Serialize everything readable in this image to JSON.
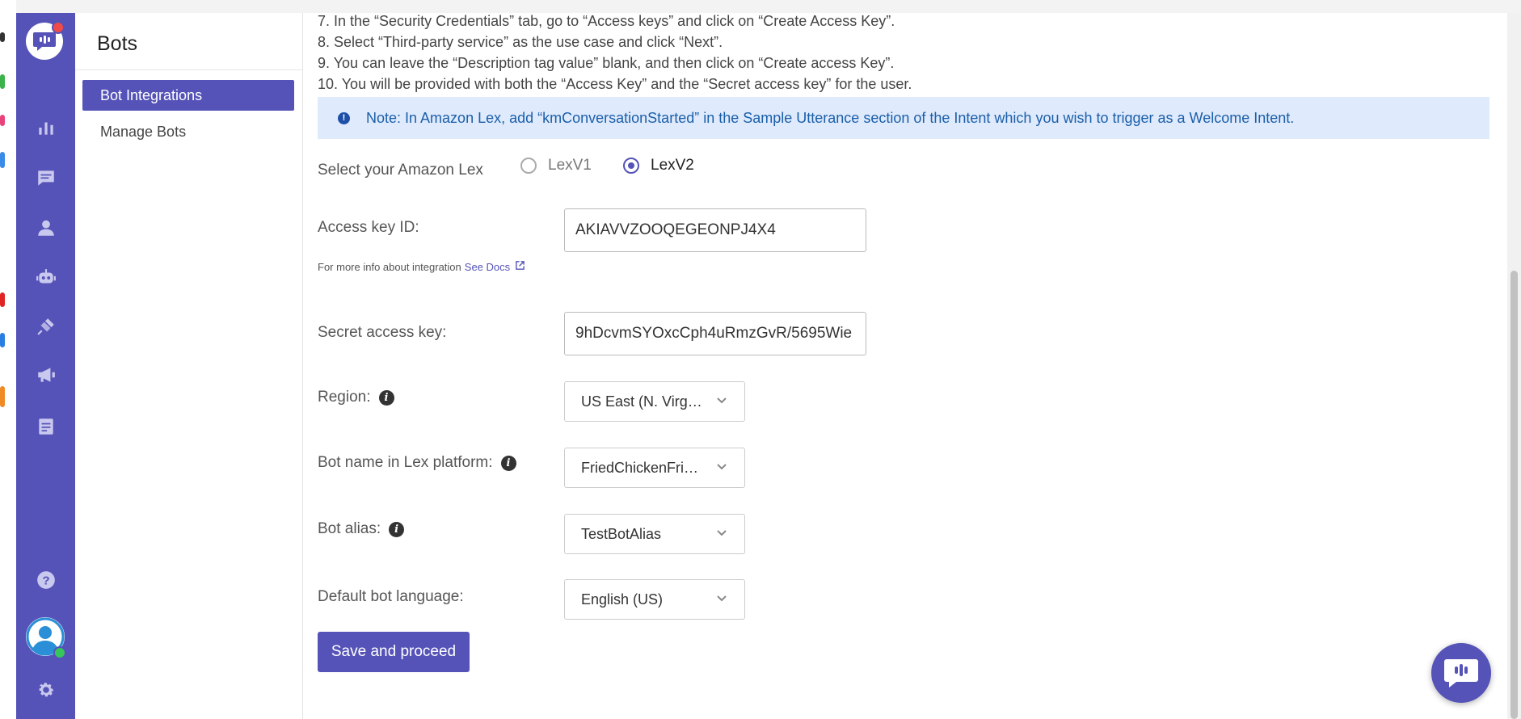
{
  "colors": {
    "brand": "#5553b7",
    "note_bg": "#dfeafd",
    "note_text": "#1b5fa8",
    "online": "#35c759",
    "notification": "#f04a4a"
  },
  "rail": {
    "icons": [
      "logo-chat-icon",
      "reports-icon",
      "conversations-icon",
      "users-icon",
      "bot-icon",
      "integrations-icon",
      "campaigns-icon",
      "docs-icon",
      "help-icon",
      "avatar",
      "settings-icon"
    ]
  },
  "sidebar": {
    "title": "Bots",
    "items": [
      {
        "label": "Bot Integrations",
        "active": true
      },
      {
        "label": "Manage Bots",
        "active": false
      }
    ]
  },
  "main": {
    "steps": [
      "7. In the “Security Credentials” tab, go to “Access keys” and click on “Create Access Key”.",
      "8. Select “Third-party service” as the use case and click “Next”.",
      "9. You can leave the “Description tag value” blank, and then click on “Create access Key”.",
      "10. You will be provided with both the “Access Key” and the “Secret access key” for the user."
    ],
    "note": "Note: In Amazon Lex, add “kmConversationStarted” in the Sample Utterance section of the Intent which you wish to trigger as a Welcome Intent.",
    "lex_select": {
      "label": "Select your Amazon Lex",
      "options": [
        "LexV1",
        "LexV2"
      ],
      "selected": "LexV2"
    },
    "access_key": {
      "label": "Access key ID:",
      "value": "AKIAVVZOOQEGEONPJ4X4"
    },
    "docs": {
      "prefix": "For more info about integration",
      "link": "See Docs"
    },
    "secret_key": {
      "label": "Secret access key:",
      "value": "9hDcvmSYOxcCph4uRmzGvR/5695Wie"
    },
    "region": {
      "label": "Region:",
      "value": "US East (N. Virginia)"
    },
    "bot_name": {
      "label": "Bot name in Lex platform:",
      "value": "FriedChickenFriendBot"
    },
    "bot_alias": {
      "label": "Bot alias:",
      "value": "TestBotAlias"
    },
    "language": {
      "label": "Default bot language:",
      "value": "English (US)"
    },
    "save_button": "Save and proceed"
  }
}
